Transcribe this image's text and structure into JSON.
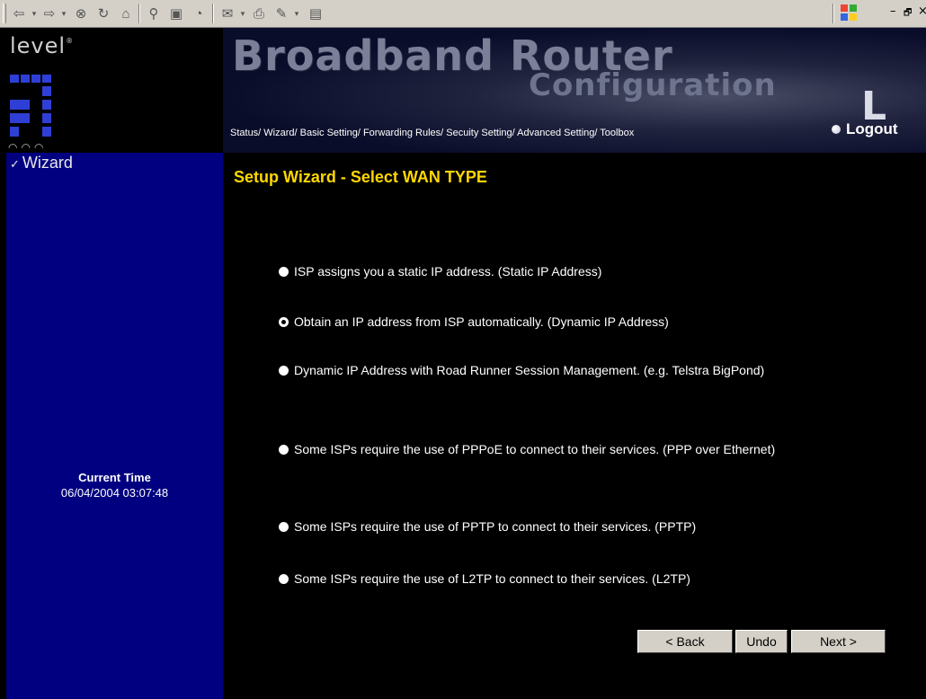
{
  "toolbar": {
    "icons": [
      "back-icon",
      "forward-icon",
      "stop-icon",
      "refresh-icon",
      "home-icon",
      "search-icon",
      "favorites-icon",
      "history-icon",
      "mail-icon",
      "print-icon",
      "edit-icon",
      "discuss-icon"
    ],
    "window_controls": {
      "minimize": "–",
      "restore": "🗗",
      "close": "×"
    }
  },
  "logo": {
    "text": "level",
    "mark": "®"
  },
  "sidebar": {
    "section_label": "Wizard",
    "current_time_label": "Current Time",
    "current_time_value": "06/04/2004 03:07:48"
  },
  "header": {
    "title_line1": "Broadband Router",
    "title_line2": "Configuration",
    "brand_letter": "L",
    "nav": "Status/ Wizard/ Basic Setting/ Forwarding Rules/ Secuity Setting/ Advanced Setting/ Toolbox",
    "logout": "Logout"
  },
  "main": {
    "title": "Setup Wizard - Select WAN TYPE",
    "options": [
      {
        "label": "ISP assigns you a static IP address. (Static IP Address)",
        "checked": false
      },
      {
        "label": "Obtain an IP address from ISP automatically. (Dynamic IP Address)",
        "checked": true
      },
      {
        "label": "Dynamic IP Address with Road Runner Session Management. (e.g. Telstra BigPond)",
        "checked": false
      },
      {
        "label": "Some ISPs require the use of PPPoE to connect to their services. (PPP over Ethernet)",
        "checked": false
      },
      {
        "label": "Some ISPs require the use of PPTP to connect to their services. (PPTP)",
        "checked": false
      },
      {
        "label": "Some ISPs require the use of L2TP to connect to their services. (L2TP)",
        "checked": false
      }
    ],
    "buttons": {
      "back": "< Back",
      "undo": "Undo",
      "next": "Next >"
    }
  },
  "colors": {
    "title": "#ffd700",
    "sidebar": "#000080",
    "accent_blocks": "#2f3fd6"
  }
}
